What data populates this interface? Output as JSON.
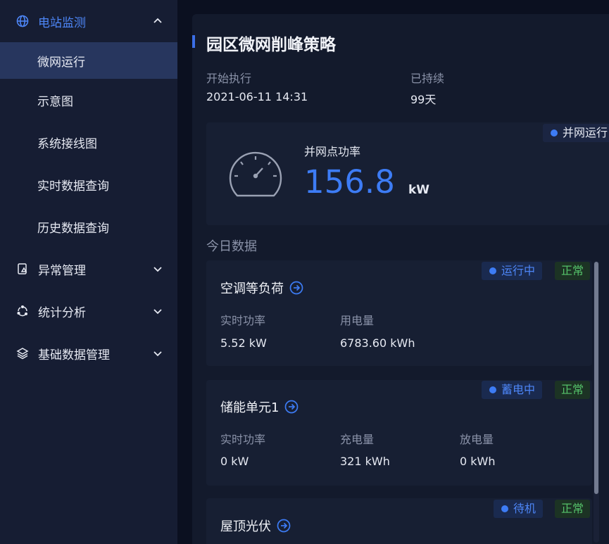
{
  "sidebar": {
    "groups": [
      {
        "label": "电站监测",
        "icon": "globe-icon"
      },
      {
        "label": "异常管理",
        "icon": "alert-doc-icon"
      },
      {
        "label": "统计分析",
        "icon": "cycle-icon"
      },
      {
        "label": "基础数据管理",
        "icon": "layers-icon"
      }
    ],
    "items": [
      {
        "label": "微网运行"
      },
      {
        "label": "示意图"
      },
      {
        "label": "系统接线图"
      },
      {
        "label": "实时数据查询"
      },
      {
        "label": "历史数据查询"
      }
    ]
  },
  "page": {
    "title": "园区微网削峰策略",
    "start_label": "开始执行",
    "start_value": "2021-06-11 14:31",
    "duration_label": "已持续",
    "duration_value": "99天"
  },
  "power": {
    "status": "并网运行",
    "label": "并网点功率",
    "value": "156.8",
    "unit": "kW"
  },
  "today_label": "今日数据",
  "devices": [
    {
      "name": "空调等负荷",
      "status": "运行中",
      "health": "正常",
      "fields": [
        {
          "label": "实时功率",
          "value": "5.52 kW"
        },
        {
          "label": "用电量",
          "value": "6783.60 kWh"
        }
      ]
    },
    {
      "name": "储能单元1",
      "status": "蓄电中",
      "health": "正常",
      "fields": [
        {
          "label": "实时功率",
          "value": "0 kW"
        },
        {
          "label": "充电量",
          "value": "321 kWh"
        },
        {
          "label": "放电量",
          "value": "0 kWh"
        }
      ]
    },
    {
      "name": "屋顶光伏",
      "status": "待机",
      "health": "正常"
    }
  ],
  "colors": {
    "accent": "#3d7cf5",
    "normal": "#55c26a",
    "sidebar_bg": "#161d33",
    "selected_bg": "#27365e"
  }
}
